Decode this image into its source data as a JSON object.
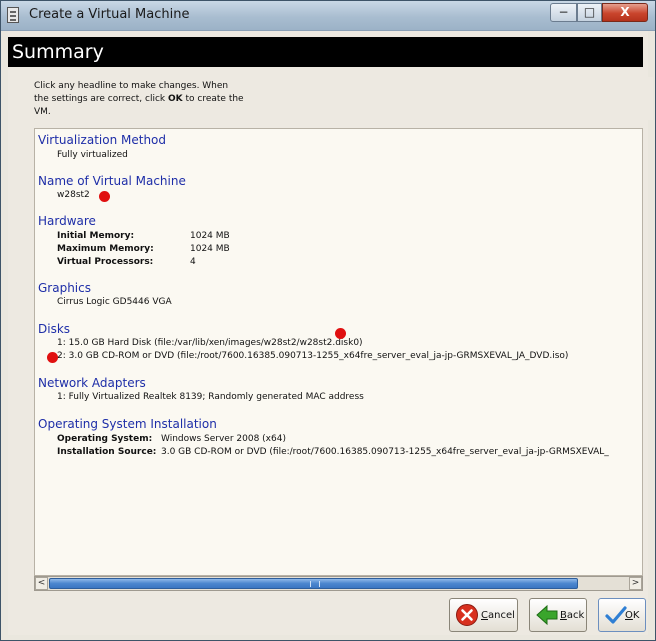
{
  "window": {
    "title": "Create a Virtual Machine",
    "controls": {
      "minimize": "−",
      "maximize": "□",
      "close": "X"
    }
  },
  "header": {
    "title": "Summary"
  },
  "instructions": {
    "line1": "Click any headline to make changes.  When",
    "line2_pre": "the settings are correct, click ",
    "line2_bold": "OK",
    "line2_post": " to create the",
    "line3": "VM."
  },
  "sections": {
    "virtualization": {
      "title": "Virtualization Method",
      "value": "Fully virtualized"
    },
    "name": {
      "title": "Name of Virtual Machine",
      "value": "w28st2"
    },
    "hardware": {
      "title": "Hardware",
      "rows": [
        {
          "label": "Initial Memory:",
          "value": "1024 MB"
        },
        {
          "label": "Maximum Memory:",
          "value": "1024 MB"
        },
        {
          "label": "Virtual Processors:",
          "value": "4"
        }
      ]
    },
    "graphics": {
      "title": "Graphics",
      "value": "Cirrus Logic GD5446 VGA"
    },
    "disks": {
      "title": "Disks",
      "items": [
        "1: 15.0 GB Hard Disk (file:/var/lib/xen/images/w28st2/w28st2.disk0)",
        "2: 3.0 GB CD-ROM or DVD (file:/root/7600.16385.090713-1255_x64fre_server_eval_ja-jp-GRMSXEVAL_JA_DVD.iso)"
      ]
    },
    "network": {
      "title": "Network Adapters",
      "value": "1: Fully Virtualized Realtek 8139; Randomly generated MAC address"
    },
    "os": {
      "title": "Operating System Installation",
      "rows": [
        {
          "label": "Operating System:",
          "value": "Windows Server 2008 (x64)"
        },
        {
          "label": "Installation Source:",
          "value": "3.0 GB CD-ROM or DVD (file:/root/7600.16385.090713-1255_x64fre_server_eval_ja-jp-GRMSXEVAL_"
        }
      ]
    }
  },
  "scrollbar": {
    "left_arrow": "<",
    "right_arrow": ">"
  },
  "buttons": {
    "cancel_prefix": "C",
    "cancel_rest": "ancel",
    "back_prefix": "B",
    "back_rest": "ack",
    "ok_prefix": "O",
    "ok_rest": "K"
  },
  "colors": {
    "section_title": "#1e2ea8",
    "marker_dot": "#e01010",
    "header_bg": "#000000"
  }
}
